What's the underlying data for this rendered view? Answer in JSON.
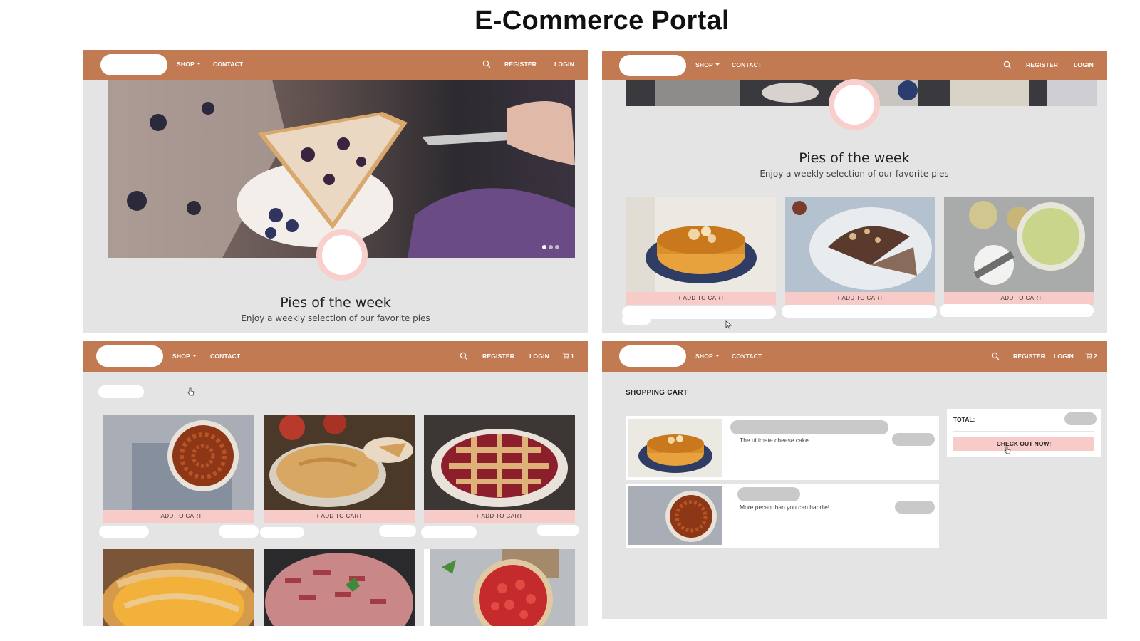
{
  "page_title": "E-Commerce Portal",
  "nav": {
    "shop": "SHOP",
    "contact": "CONTACT",
    "register": "REGISTER",
    "login": "LOGIN",
    "cart_count_1": "1",
    "cart_count_2": "2"
  },
  "home": {
    "section_title": "Pies of the week",
    "section_subtitle": "Enjoy a weekly selection of our favorite pies",
    "carousel_dots": 3,
    "carousel_active": 1
  },
  "products": {
    "add_to_cart": "+ ADD TO CART"
  },
  "cart": {
    "heading": "SHOPPING CART",
    "items": [
      {
        "description": "The ultimate cheese cake"
      },
      {
        "description": "More pecan than you can handle!"
      }
    ],
    "total_label": "TOTAL:",
    "checkout_label": "CHECK OUT NOW!"
  },
  "colors": {
    "nav": "#c17a51",
    "button": "#f7cbc8",
    "panel": "#e4e4e4"
  }
}
